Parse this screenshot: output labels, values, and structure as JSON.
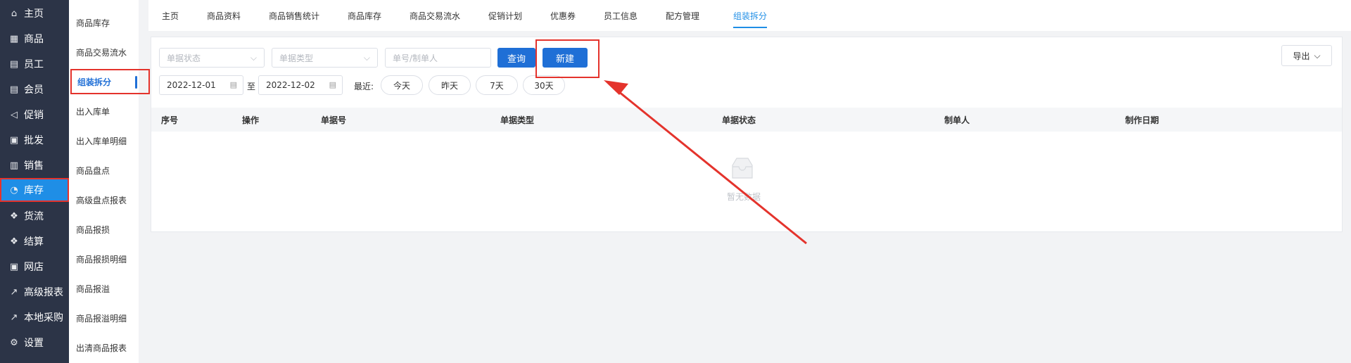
{
  "sidebar": {
    "items": [
      {
        "label": "主页",
        "icon": "home-icon",
        "glyph": "⌂"
      },
      {
        "label": "商品",
        "icon": "grid-icon",
        "glyph": "▦"
      },
      {
        "label": "员工",
        "icon": "id-card-icon",
        "glyph": "▤"
      },
      {
        "label": "会员",
        "icon": "member-card-icon",
        "glyph": "▤"
      },
      {
        "label": "促销",
        "icon": "megaphone-icon",
        "glyph": "◁"
      },
      {
        "label": "批发",
        "icon": "document-icon",
        "glyph": "▣"
      },
      {
        "label": "销售",
        "icon": "bar-chart-icon",
        "glyph": "▥"
      },
      {
        "label": "库存",
        "icon": "pie-chart-icon",
        "glyph": "◔"
      },
      {
        "label": "货流",
        "icon": "cube-icon",
        "glyph": "❖"
      },
      {
        "label": "结算",
        "icon": "settlement-icon",
        "glyph": "❖"
      },
      {
        "label": "网店",
        "icon": "gift-icon",
        "glyph": "▣"
      },
      {
        "label": "高级报表",
        "icon": "line-chart-icon",
        "glyph": "↗"
      },
      {
        "label": "本地采购",
        "icon": "trend-icon",
        "glyph": "↗"
      },
      {
        "label": "设置",
        "icon": "gear-icon",
        "glyph": "⚙"
      }
    ],
    "active": "库存"
  },
  "subnav": {
    "items": [
      "商品库存",
      "商品交易流水",
      "组装拆分",
      "出入库单",
      "出入库单明细",
      "商品盘点",
      "高级盘点报表",
      "商品报损",
      "商品报损明细",
      "商品报溢",
      "商品报溢明细",
      "出清商品报表"
    ],
    "active": "组装拆分"
  },
  "tabs": {
    "items": [
      "主页",
      "商品资料",
      "商品销售统计",
      "商品库存",
      "商品交易流水",
      "促销计划",
      "优惠券",
      "员工信息",
      "配方管理",
      "组装拆分"
    ],
    "active": "组装拆分"
  },
  "filters": {
    "status_placeholder": "单据状态",
    "type_placeholder": "单据类型",
    "search_placeholder": "单号/制单人",
    "query_label": "查询",
    "new_label": "新建",
    "date_from": "2022-12-01",
    "date_separator": "至",
    "date_to": "2022-12-02",
    "recent_label": "最近:",
    "quick_ranges": [
      "今天",
      "昨天",
      "7天",
      "30天"
    ],
    "export_label": "导出"
  },
  "table": {
    "columns": [
      "序号",
      "操作",
      "单据号",
      "单据类型",
      "单据状态",
      "制单人",
      "制作日期"
    ],
    "empty_text": "暂无数据"
  },
  "colors": {
    "primary": "#1f6fd6",
    "sidebar_bg": "#2c3447",
    "active_nav": "#1f8ee6",
    "annotation": "#e4332c"
  }
}
